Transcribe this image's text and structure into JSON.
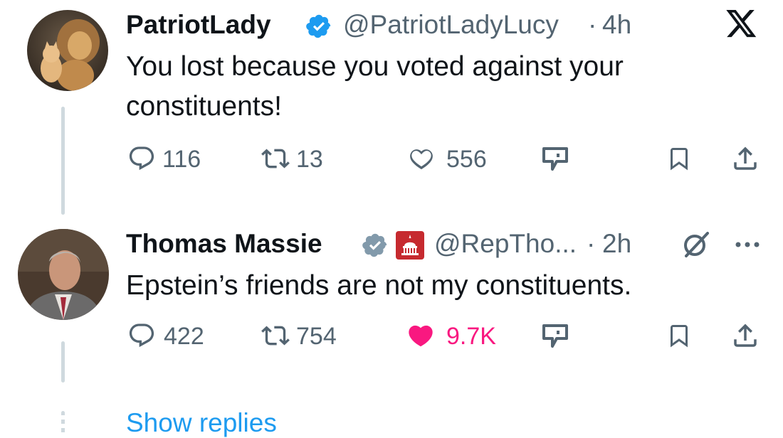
{
  "tweets": [
    {
      "display_name": "PatriotLady",
      "handle": "@PatriotLadyLucy",
      "time": "4h",
      "text": "You lost because you voted against your constituents!",
      "replies": "116",
      "reposts": "13",
      "likes": "556",
      "liked": false,
      "avatar_icon": "lion-and-kitten-avatar"
    },
    {
      "display_name": "Thomas Massie",
      "handle": "@RepTho...",
      "time": "2h",
      "text": "Epstein’s friends are not my constituents.",
      "replies": "422",
      "reposts": "754",
      "likes": "9.7K",
      "liked": true,
      "avatar_icon": "man-in-suit-avatar"
    }
  ],
  "separator": "·",
  "show_replies": "Show replies",
  "colors": {
    "verified_blue": "#1d9bf0",
    "government_grey": "#829aab",
    "like_pink": "#f91880",
    "muted_text": "#536471",
    "link_blue": "#1d9bf0"
  }
}
